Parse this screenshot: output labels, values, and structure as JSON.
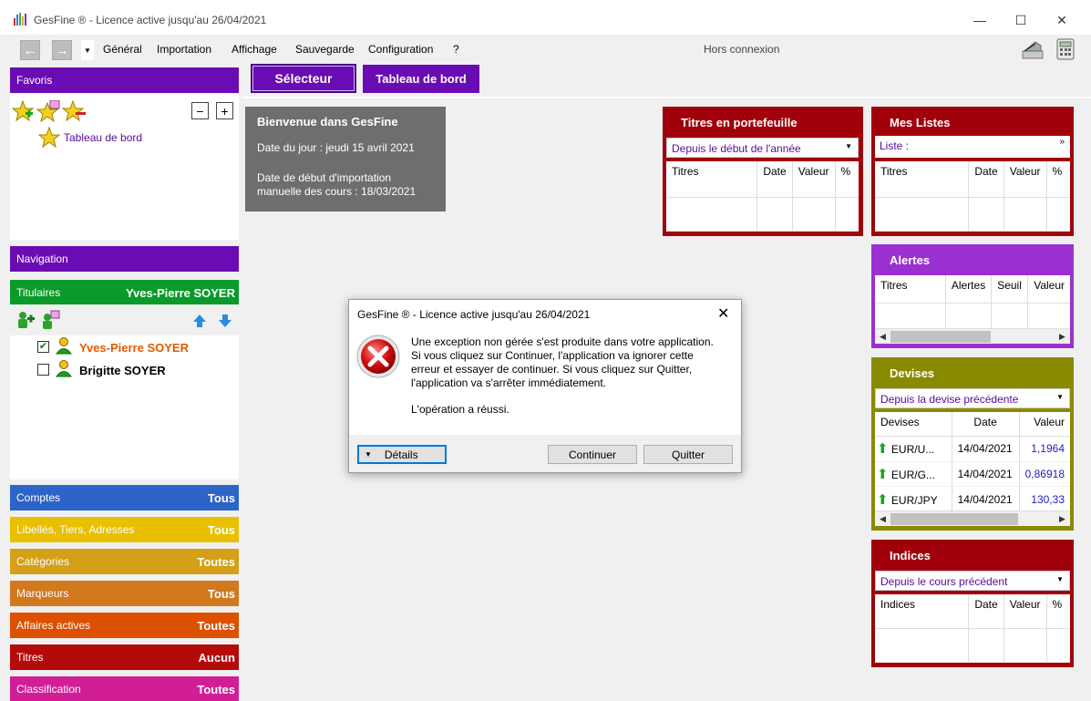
{
  "window": {
    "title": "GesFine ® - Licence active jusqu'au 26/04/2021",
    "minimize": "—",
    "maximize": "☐",
    "close": "✕"
  },
  "menu": {
    "back": "←",
    "forward": "→",
    "dropdown": "▼",
    "items": [
      "Général",
      "Importation",
      "Affichage",
      "Sauvegarde",
      "Configuration",
      "?"
    ],
    "status": "Hors connexion"
  },
  "tabs": {
    "selecteur": "Sélecteur",
    "tableau_de_bord": "Tableau de bord"
  },
  "sidebar": {
    "favoris": {
      "title": "Favoris",
      "minus": "−",
      "plus": "+",
      "items": [
        "Tableau de bord"
      ]
    },
    "navigation": {
      "title": "Navigation"
    },
    "titulaires": {
      "title": "Titulaires",
      "selected": "Yves-Pierre SOYER",
      "people": [
        {
          "name": "Yves-Pierre SOYER",
          "checked": true,
          "color": "#e05a00"
        },
        {
          "name": "Brigitte SOYER",
          "checked": false,
          "color": "#000000"
        }
      ]
    },
    "sections": [
      {
        "label": "Comptes",
        "value": "Tous",
        "color": "#2c64c8"
      },
      {
        "label": "Libellés, Tiers, Adresses",
        "value": "Tous",
        "color": "#e8c000"
      },
      {
        "label": "Catégories",
        "value": "Toutes",
        "color": "#d4a017"
      },
      {
        "label": "Marqueurs",
        "value": "Tous",
        "color": "#d2781e"
      },
      {
        "label": "Affaires actives",
        "value": "Toutes",
        "color": "#dc5000"
      },
      {
        "label": "Titres",
        "value": "Aucun",
        "color": "#b40a0a"
      },
      {
        "label": "Classification",
        "value": "Toutes",
        "color": "#d21e96"
      }
    ]
  },
  "welcome": {
    "title": "Bienvenue dans GesFine",
    "date_line": "Date du jour : jeudi 15 avril 2021",
    "import_line": "Date de début d'importation manuelle des cours : 18/03/2021"
  },
  "widgets": {
    "titres": {
      "title": "Titres en portefeuille",
      "select": "Depuis le début de l'année",
      "columns": [
        "Titres",
        "Date",
        "Valeur",
        "%"
      ]
    },
    "mes_listes": {
      "title": "Mes Listes",
      "select": "Liste :",
      "more": "»",
      "columns": [
        "Titres",
        "Date",
        "Valeur",
        "%"
      ]
    },
    "alertes": {
      "title": "Alertes",
      "columns": [
        "Titres",
        "Alertes",
        "Seuil",
        "Valeur"
      ]
    },
    "devises": {
      "title": "Devises",
      "select": "Depuis la devise précédente",
      "columns": [
        "Devises",
        "Date",
        "Valeur"
      ],
      "rows": [
        {
          "devise": "EUR/U...",
          "date": "14/04/2021",
          "valeur": "1,1964"
        },
        {
          "devise": "EUR/G...",
          "date": "14/04/2021",
          "valeur": "0,86918"
        },
        {
          "devise": "EUR/JPY",
          "date": "14/04/2021",
          "valeur": "130,33"
        }
      ]
    },
    "indices": {
      "title": "Indices",
      "select": "Depuis le cours précédent",
      "columns": [
        "Indices",
        "Date",
        "Valeur",
        "%"
      ]
    }
  },
  "dialog": {
    "title": "GesFine ® - Licence active jusqu'au 26/04/2021",
    "close": "✕",
    "message": "Une exception non gérée s'est produite dans votre application.\nSi vous cliquez sur Continuer, l'application va ignorer cette\nerreur et essayer de continuer. Si vous cliquez sur Quitter,\nl'application va s'arrêter immédiatement.",
    "result": "L'opération a réussi.",
    "details": "Détails",
    "continuer": "Continuer",
    "quitter": "Quitter"
  },
  "colors": {
    "purple": "#6a0cb3",
    "green_header": "#0a9a2a",
    "dark_red": "#a0000a",
    "violet": "#9b30d0",
    "olive": "#8a8a00",
    "link_purple": "#5a0a9a"
  }
}
